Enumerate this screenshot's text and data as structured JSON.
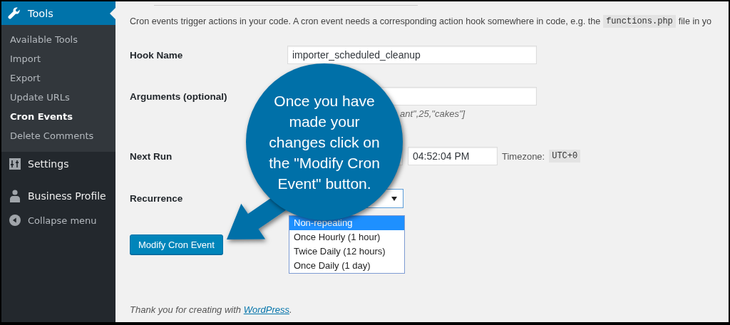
{
  "sidebar": {
    "header": {
      "label": "Tools",
      "selected": true
    },
    "submenu": [
      {
        "label": "Available Tools",
        "selected": false
      },
      {
        "label": "Import",
        "selected": false
      },
      {
        "label": "Export",
        "selected": false
      },
      {
        "label": "Update URLs",
        "selected": false
      },
      {
        "label": "Cron Events",
        "selected": true
      },
      {
        "label": "Delete Comments",
        "selected": false
      }
    ],
    "items": [
      {
        "label": "Settings",
        "kind": "settings"
      },
      {
        "label": "Business Profile",
        "kind": "profile"
      },
      {
        "label": "Collapse menu",
        "kind": "collapse"
      }
    ]
  },
  "intro": {
    "text": "Cron events trigger actions in your code. A cron event needs a corresponding action hook somewhere in code, e.g. the",
    "code": "functions.php",
    "text_end": "file in yo"
  },
  "form": {
    "fields": [
      {
        "label": "Hook Name",
        "kind": "text",
        "value": "importer_scheduled_cleanup"
      },
      {
        "label": "Arguments (optional)",
        "kind": "args",
        "hint": "ant\",25,\"cakes\"]"
      },
      {
        "label": "Next Run",
        "kind": "datetime",
        "time": "04:52:04 PM",
        "timezone_label": "Timezone:",
        "timezone": "UTC+0"
      },
      {
        "label": "Recurrence",
        "kind": "select",
        "options": [
          {
            "label": "Non-repeating",
            "selected": true
          },
          {
            "label": "Once Hourly (1 hour)",
            "selected": false
          },
          {
            "label": "Twice Daily (12 hours)",
            "selected": false
          },
          {
            "label": "Once Daily (1 day)",
            "selected": false
          }
        ]
      }
    ]
  },
  "submit": {
    "label": "Modify Cron Event"
  },
  "footer": {
    "text": "Thank you for creating with ",
    "link": "WordPress",
    "end": "."
  },
  "callout": {
    "text": "Once you have made your changes click on the \"Modify Cron Event\" button."
  }
}
